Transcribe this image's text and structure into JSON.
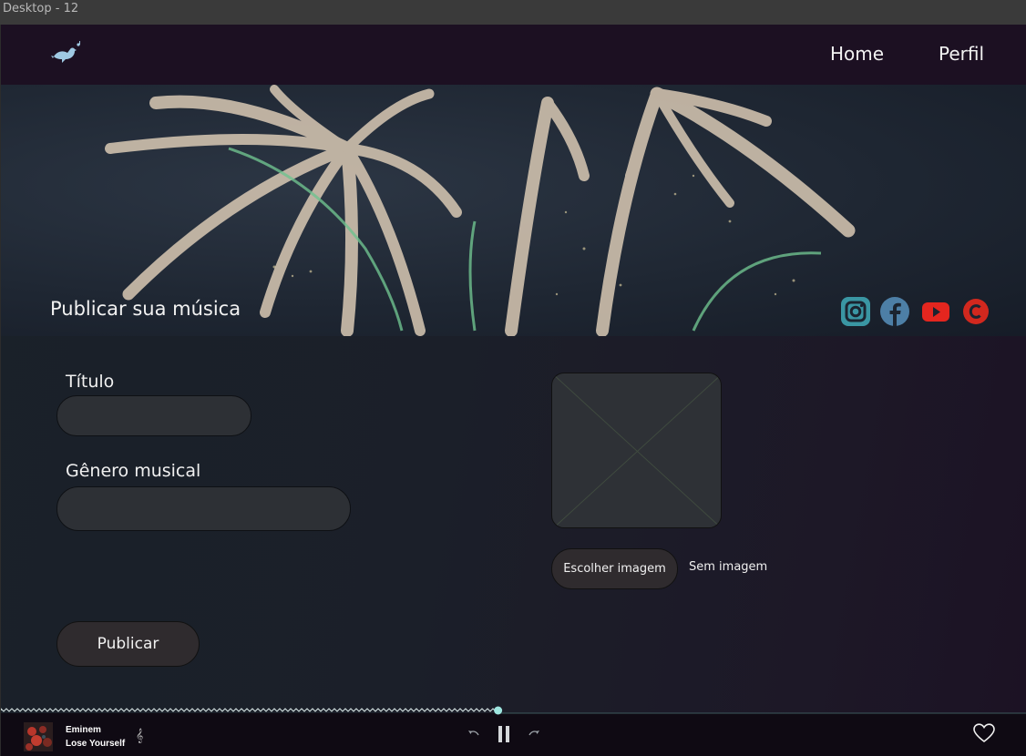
{
  "frame": {
    "label": "Desktop - 12"
  },
  "nav": {
    "home": "Home",
    "perfil": "Perfil"
  },
  "hero": {
    "title": "Publicar sua música"
  },
  "social_icons": [
    "instagram-icon",
    "facebook-icon",
    "youtube-icon",
    "c-icon"
  ],
  "form": {
    "title_label": "Título",
    "title_value": "",
    "genre_label": "Gênero musical",
    "genre_value": "",
    "publish_label": "Publicar"
  },
  "image": {
    "choose_label": "Escolher imagem",
    "status": "Sem imagem"
  },
  "player": {
    "artist": "Eminem",
    "song": "Lose Yourself",
    "progress": 0.485
  },
  "colors": {
    "nav_bg": "#1c1022",
    "player_bg": "#0f0a13",
    "accent": "#9ee6df",
    "instagram": "#3a96a3",
    "facebook": "#4d7fa6",
    "youtube": "#e4261f",
    "c_brand": "#d2281e"
  }
}
